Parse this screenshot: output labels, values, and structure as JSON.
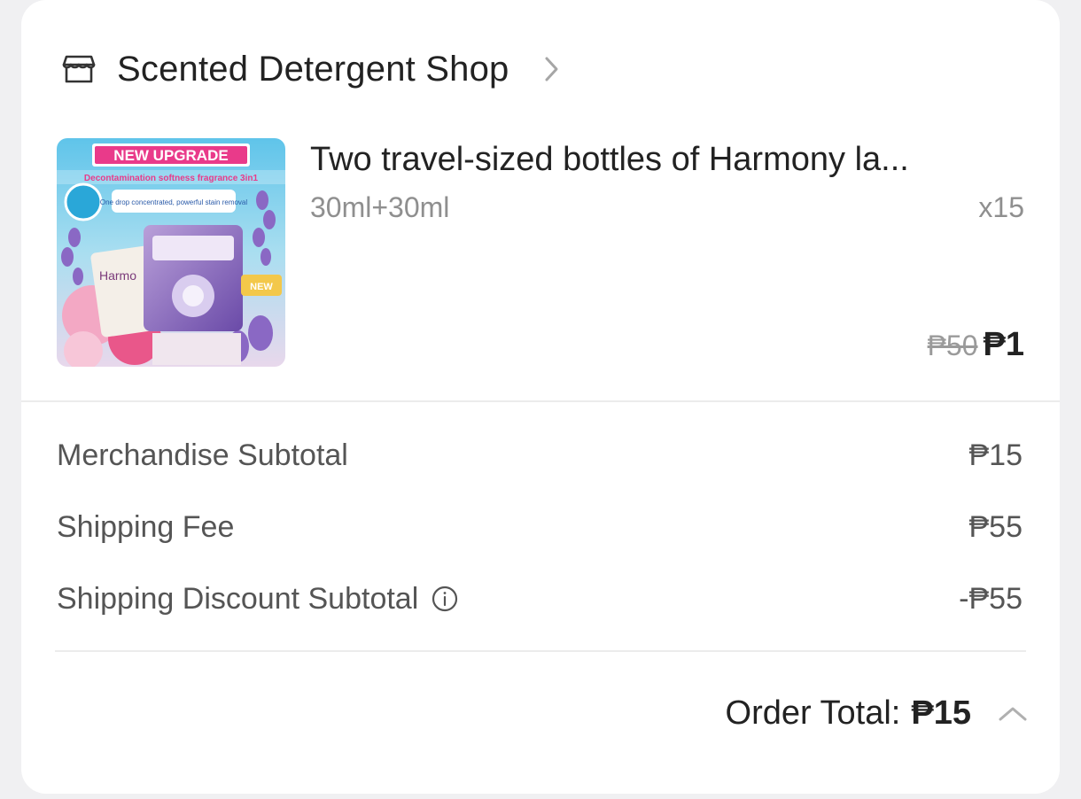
{
  "shop": {
    "icon": "store-icon",
    "name": "Scented Detergent Shop",
    "chevron_icon": "chevron-right-icon"
  },
  "product": {
    "image_text": {
      "badge": "NEW UPGRADE",
      "tagline": "Decontamination softness fragrance 3in1",
      "subline": "One drop concentrated, powerful stain removal",
      "brand": "Harmo",
      "sticker": "NEW"
    },
    "title": "Two travel-sized bottles of Harmony la...",
    "variant": "30ml+30ml",
    "quantity": "x15",
    "original_price": "₱50",
    "price": "₱1"
  },
  "summary": {
    "rows": [
      {
        "label": "Merchandise Subtotal",
        "value": "₱15"
      },
      {
        "label": "Shipping Fee",
        "value": "₱55"
      },
      {
        "label": "Shipping Discount Subtotal",
        "value": "-₱55",
        "info_icon": "info-icon"
      }
    ],
    "order_total_label": "Order Total:",
    "order_total_value": "₱15",
    "expand_icon": "chevron-up-icon"
  },
  "colors": {
    "background": "#f0f0f2",
    "card": "#ffffff",
    "text_primary": "#222222",
    "text_secondary": "#8f8f8f"
  }
}
